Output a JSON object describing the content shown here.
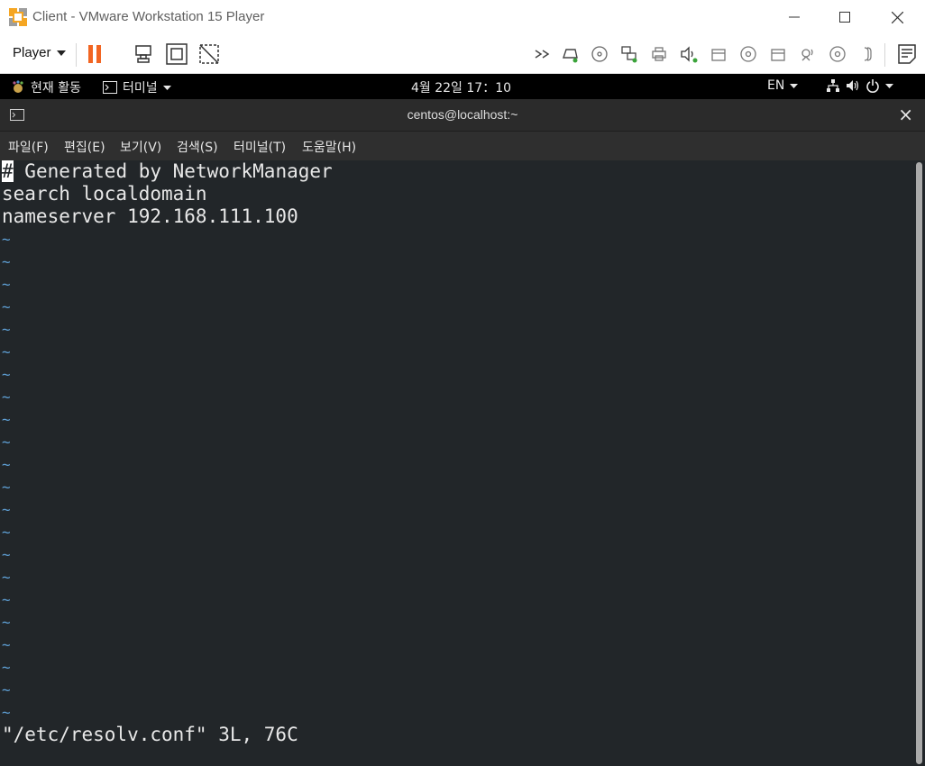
{
  "window": {
    "title": "Client - VMware Workstation 15 Player"
  },
  "toolbar": {
    "player_label": "Player"
  },
  "gnome_bar": {
    "activities": "현재 활동",
    "app_menu": "터미널",
    "clock": "4월 22일  17：10",
    "input_lang": "EN"
  },
  "terminal": {
    "title": "centos@localhost:~",
    "close_glyph": "×",
    "menu": [
      {
        "label": "파일(F)"
      },
      {
        "label": "편집(E)"
      },
      {
        "label": "보기(V)"
      },
      {
        "label": "검색(S)"
      },
      {
        "label": "터미널(T)"
      },
      {
        "label": "도움말(H)"
      }
    ],
    "cursor_char": "#",
    "line1_rest": " Generated by NetworkManager",
    "line2": "search localdomain",
    "line3": "nameserver 192.168.111.100",
    "tilde": "~",
    "status_line": "\"/etc/resolv.conf\" 3L, 76C"
  }
}
